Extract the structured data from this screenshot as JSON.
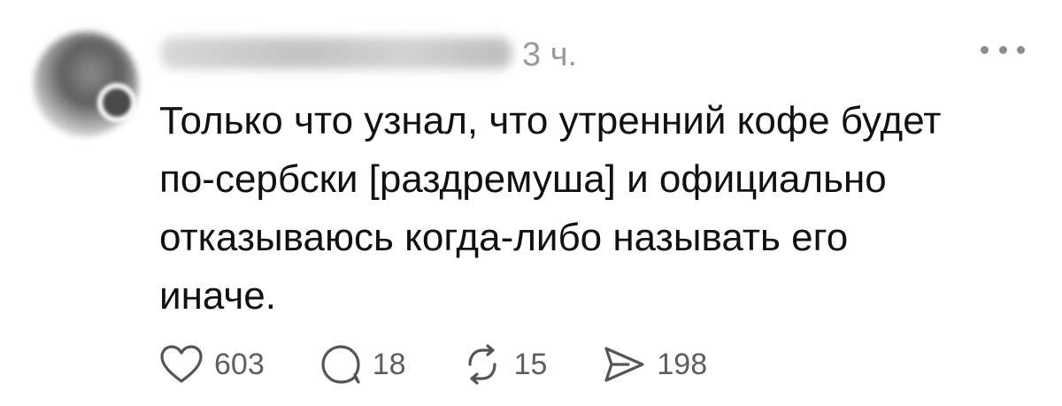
{
  "post": {
    "username": "sergeevich_rafael",
    "time": "3 ч.",
    "text_lines": [
      "Только что узнал, что утренний кофе будет",
      "по-сербски [раздремуша] и официально",
      "отказываюсь когда-либо называть его",
      "иначе."
    ]
  },
  "actions": {
    "like": {
      "icon": "heart-icon",
      "count": "603"
    },
    "reply": {
      "icon": "comment-icon",
      "count": "18"
    },
    "repost": {
      "icon": "repost-icon",
      "count": "15"
    },
    "share": {
      "icon": "share-icon",
      "count": "198"
    }
  },
  "colors": {
    "text": "#111111",
    "muted": "#9a9a9a",
    "icon": "#555555"
  }
}
